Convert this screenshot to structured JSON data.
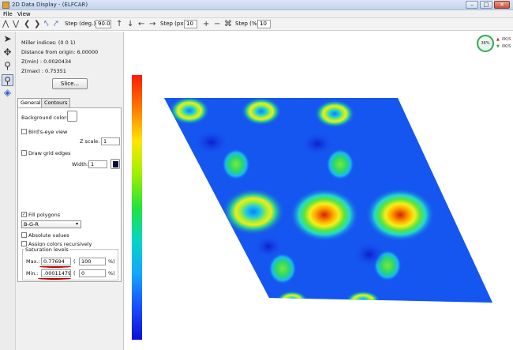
{
  "window": {
    "title": "2D Data Display - (ELFCAR)",
    "min": "–",
    "max": "□",
    "close": "✕"
  },
  "menu": [
    "File",
    "View"
  ],
  "toolbar": {
    "step_deg_label": "Step (deg.):",
    "step_deg_value": "90.0",
    "step_px_label": "Step (px):",
    "step_px_value": "10",
    "step_pct_label": "Step (%):",
    "step_pct_value": "10"
  },
  "info": {
    "miller": "Miller indices: (0 0 1)",
    "distance": "Distance from origin: 6.00000",
    "zmin": "Z(min) : 0.0020434",
    "zmax": "Z(max) : 0.75351",
    "slice_button": "Slice..."
  },
  "tabs": [
    "General",
    "Contours"
  ],
  "general": {
    "bg_color_label": "Background color:",
    "birds_eye_label": "Bird's-eye view",
    "zscale_label": "Z scale:",
    "zscale_value": "1",
    "draw_grid_label": "Draw grid edges",
    "width_label": "Width:",
    "width_value": "1",
    "fill_polygons_label": "Fill polygons",
    "colormap_value": "B-G-R",
    "absolute_values_label": "Absolute values",
    "assign_colors_label": "Assign colors recursively",
    "saturation_title": "Saturation levels",
    "max_label": "Max.:",
    "max_value": "0.77694",
    "max_pct": "100",
    "min_label": "Min.:",
    "min_value": ".00011479",
    "min_pct": "0",
    "paren_open": "(",
    "pct_suffix": "%)"
  },
  "indicator": {
    "percent": "36%",
    "up_rate": "0K/S",
    "down_rate": "0K/S"
  },
  "colors": {
    "colorbar_stops": [
      "#ff1a00",
      "#ff7a00",
      "#ffe600",
      "#9ef000",
      "#22e43a",
      "#00d7c4",
      "#14a6ff",
      "#1a4dff",
      "#0a10d8"
    ],
    "plot_background": "#1550ee",
    "annotation_red": "#c40000"
  }
}
